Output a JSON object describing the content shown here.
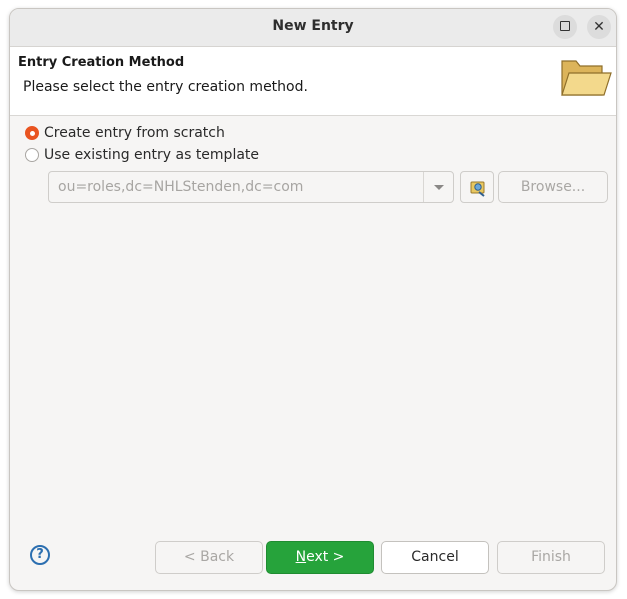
{
  "window": {
    "title": "New Entry"
  },
  "header": {
    "title": "Entry Creation Method",
    "description": "Please select the entry creation method.",
    "icon": "open-folder-icon"
  },
  "options": [
    {
      "label": "Create entry from scratch",
      "selected": true
    },
    {
      "label": "Use existing entry as template",
      "selected": false
    }
  ],
  "template": {
    "value": "ou=roles,dc=NHLStenden,dc=com",
    "enabled": false,
    "browse_label": "Browse..."
  },
  "buttons": {
    "back": "< Back",
    "next_mnemonic": "N",
    "next_rest": "ext >",
    "cancel": "Cancel",
    "finish": "Finish"
  },
  "colors": {
    "accent": "#e95420",
    "primary": "#26a33b",
    "help": "#2c6fb0"
  }
}
